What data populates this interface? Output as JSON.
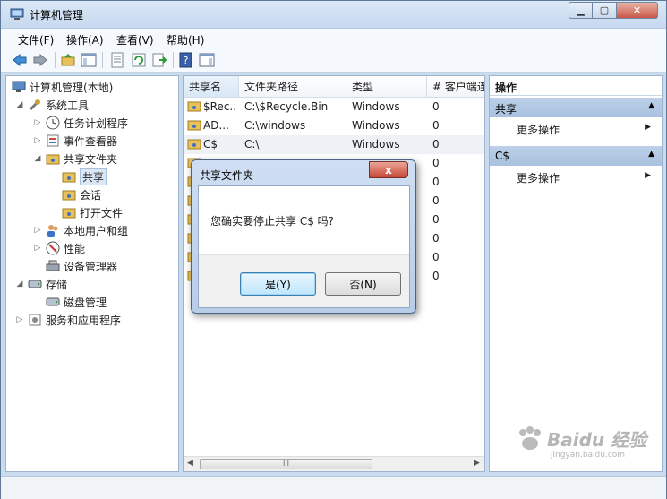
{
  "window": {
    "title": "计算机管理"
  },
  "menu": [
    "文件(F)",
    "操作(A)",
    "查看(V)",
    "帮助(H)"
  ],
  "tree": {
    "root": "计算机管理(本地)",
    "system_tools": "系统工具",
    "task_scheduler": "任务计划程序",
    "event_viewer": "事件查看器",
    "shared_folders": "共享文件夹",
    "shares": "共享",
    "sessions": "会话",
    "open_files": "打开文件",
    "local_users": "本地用户和组",
    "performance": "性能",
    "device_manager": "设备管理器",
    "storage": "存储",
    "disk_management": "磁盘管理",
    "services": "服务和应用程序"
  },
  "table": {
    "headers": [
      "共享名",
      "文件夹路径",
      "类型",
      "# 客户端连"
    ],
    "rows": [
      {
        "name": "$Rec...",
        "path": "C:\\$Recycle.Bin",
        "type": "Windows",
        "clients": "0"
      },
      {
        "name": "AD...",
        "path": "C:\\windows",
        "type": "Windows",
        "clients": "0"
      },
      {
        "name": "C$",
        "path": "C:\\",
        "type": "Windows",
        "clients": "0"
      },
      {
        "name": "",
        "path": "",
        "type": "",
        "clients": "0"
      },
      {
        "name": "",
        "path": "",
        "type": "",
        "clients": "0"
      },
      {
        "name": "",
        "path": "",
        "type": "",
        "clients": "0"
      },
      {
        "name": "",
        "path": "",
        "type": "",
        "clients": "0"
      },
      {
        "name": "",
        "path": "",
        "type": "",
        "clients": "0"
      },
      {
        "name": "",
        "path": "",
        "type": "",
        "clients": "0"
      },
      {
        "name": "",
        "path": "",
        "type": "",
        "clients": "0"
      }
    ],
    "scroll_grip": "III"
  },
  "actions": {
    "title": "操作",
    "section1": "共享",
    "section1_item": "更多操作",
    "section2": "C$",
    "section2_item": "更多操作"
  },
  "dialog": {
    "title": "共享文件夹",
    "message": "您确实要停止共享 C$ 吗?",
    "yes": "是(Y)",
    "no": "否(N)",
    "close": "x"
  },
  "watermark": {
    "brand": "Baidu 经验",
    "url": "jingyan.baidu.com"
  },
  "colors": {
    "accent": "#c9dbef",
    "section": "#b2c8e4",
    "arrow": "#e02020"
  }
}
